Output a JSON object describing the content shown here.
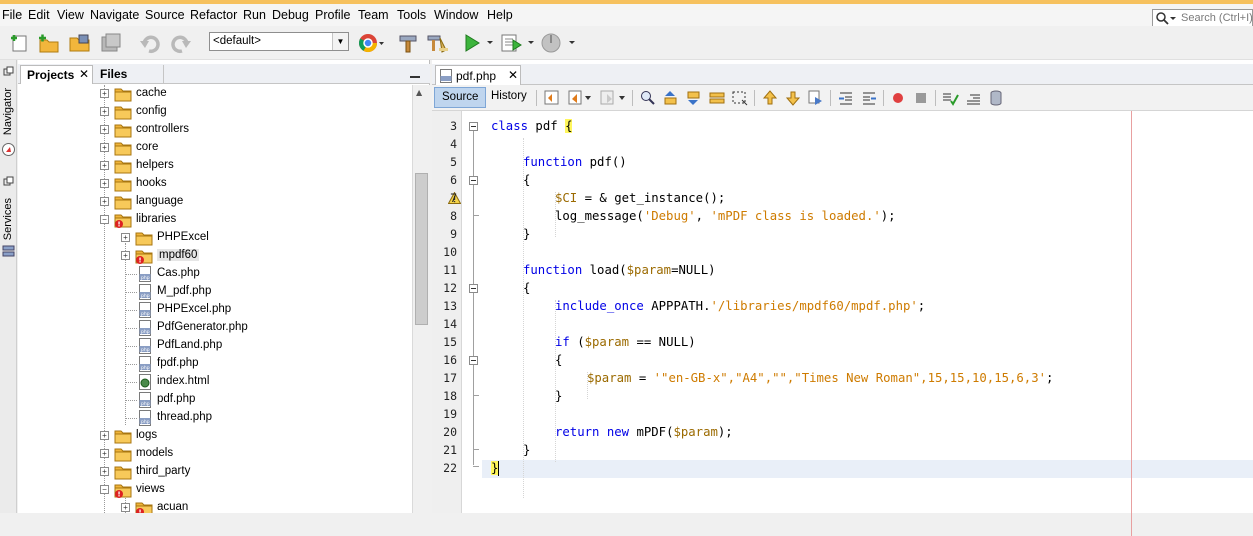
{
  "menu": [
    "File",
    "Edit",
    "View",
    "Navigate",
    "Source",
    "Refactor",
    "Run",
    "Debug",
    "Profile",
    "Team",
    "Tools",
    "Window",
    "Help"
  ],
  "search": {
    "placeholder": "Search (Ctrl+I)"
  },
  "toolbar": {
    "config_value": "<default>"
  },
  "side_tabs": {
    "navigator": "Navigator",
    "services": "Services"
  },
  "project_panel": {
    "tabs": [
      "Projects",
      "Files"
    ],
    "tree": [
      {
        "label": "cache",
        "type": "folder",
        "level": 0
      },
      {
        "label": "config",
        "type": "folder",
        "level": 0
      },
      {
        "label": "controllers",
        "type": "folder",
        "level": 0
      },
      {
        "label": "core",
        "type": "folder",
        "level": 0
      },
      {
        "label": "helpers",
        "type": "folder",
        "level": 0
      },
      {
        "label": "hooks",
        "type": "folder",
        "level": 0
      },
      {
        "label": "language",
        "type": "folder",
        "level": 0
      },
      {
        "label": "libraries",
        "type": "folder-error",
        "level": 0,
        "expanded": true
      },
      {
        "label": "PHPExcel",
        "type": "folder",
        "level": 1
      },
      {
        "label": "mpdf60",
        "type": "folder-error",
        "level": 1,
        "selected": true
      },
      {
        "label": "Cas.php",
        "type": "php",
        "level": 1
      },
      {
        "label": "M_pdf.php",
        "type": "php",
        "level": 1
      },
      {
        "label": "PHPExcel.php",
        "type": "php",
        "level": 1
      },
      {
        "label": "PdfGenerator.php",
        "type": "php",
        "level": 1
      },
      {
        "label": "PdfLand.php",
        "type": "php",
        "level": 1
      },
      {
        "label": "fpdf.php",
        "type": "php",
        "level": 1
      },
      {
        "label": "index.html",
        "type": "html",
        "level": 1
      },
      {
        "label": "pdf.php",
        "type": "php",
        "level": 1
      },
      {
        "label": "thread.php",
        "type": "php",
        "level": 1
      },
      {
        "label": "logs",
        "type": "folder",
        "level": 0
      },
      {
        "label": "models",
        "type": "folder",
        "level": 0
      },
      {
        "label": "third_party",
        "type": "folder",
        "level": 0
      },
      {
        "label": "views",
        "type": "folder-error",
        "level": 0,
        "expanded": true
      },
      {
        "label": "acuan",
        "type": "folder-error",
        "level": 1
      }
    ]
  },
  "editor": {
    "tab_label": "pdf.php",
    "view_buttons": [
      "Source",
      "History"
    ],
    "line_numbers": [
      "3",
      "4",
      "5",
      "6",
      "7",
      "8",
      "9",
      "10",
      "11",
      "12",
      "13",
      "14",
      "15",
      "16",
      "17",
      "18",
      "19",
      "20",
      "21",
      "22"
    ],
    "code": {
      "l3_a": "class",
      "l3_b": " pdf ",
      "l3_c": "{",
      "l5_a": "function",
      "l5_b": " pdf()",
      "l6": "{",
      "l7_a": "$CI",
      "l7_b": " = & get_instance();",
      "l8_a": "log_message(",
      "l8_b": "'Debug'",
      "l8_c": ", ",
      "l8_d": "'mPDF class is loaded.'",
      "l8_e": ");",
      "l9": "}",
      "l11_a": "function",
      "l11_b": " load(",
      "l11_c": "$param",
      "l11_d": "=NULL)",
      "l12": "{",
      "l13_a": "include_once",
      "l13_b": " APPPATH.",
      "l13_c": "'/libraries/mpdf60/mpdf.php'",
      "l13_d": ";",
      "l15_a": "if",
      "l15_b": " (",
      "l15_c": "$param",
      "l15_d": " == NULL)",
      "l16": "{",
      "l17_a": "$param",
      "l17_b": " = ",
      "l17_c": "'\"en-GB-x\",\"A4\",\"\",\"Times New Roman\",15,15,10,15,6,3'",
      "l17_d": ";",
      "l18": "}",
      "l20_a": "return",
      "l20_b": " ",
      "l20_c": "new",
      "l20_d": " mPDF(",
      "l20_e": "$param",
      "l20_f": ");",
      "l21": "}",
      "l22": "}"
    }
  },
  "colors": {
    "keyword": "#0000e6",
    "string": "#ce7b00",
    "variable": "#9b6a00",
    "brace_match": "#fff65c",
    "accent_stripe": "#f6c15e"
  }
}
